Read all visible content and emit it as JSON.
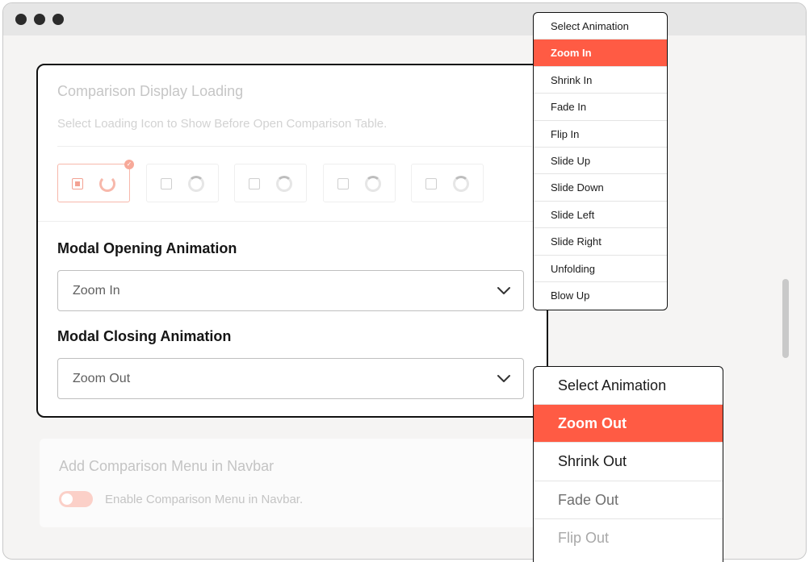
{
  "comparison_loading": {
    "title": "Comparison Display Loading",
    "description": "Select Loading Icon to Show Before Open Comparison Table."
  },
  "modal_opening": {
    "label": "Modal Opening Animation",
    "selected": "Zoom In",
    "options": [
      "Select Animation",
      "Zoom In",
      "Shrink In",
      "Fade In",
      "Flip In",
      "Slide Up",
      "Slide Down",
      "Slide Left",
      "Slide Right",
      "Unfolding",
      "Blow Up"
    ]
  },
  "modal_closing": {
    "label": "Modal Closing Animation",
    "selected": "Zoom Out",
    "options": [
      "Select Animation",
      "Zoom Out",
      "Shrink Out",
      "Fade Out",
      "Flip Out"
    ]
  },
  "navbar_menu": {
    "title": "Add Comparison Menu in Navbar",
    "toggle_label": "Enable Comparison Menu in Navbar."
  },
  "colors": {
    "accent": "#ff5b44",
    "accent_light": "#f7b8ab"
  },
  "icons": {
    "chevron": "chevron-down-icon",
    "spinner": "loading-spinner-icon",
    "check": "check-icon"
  }
}
